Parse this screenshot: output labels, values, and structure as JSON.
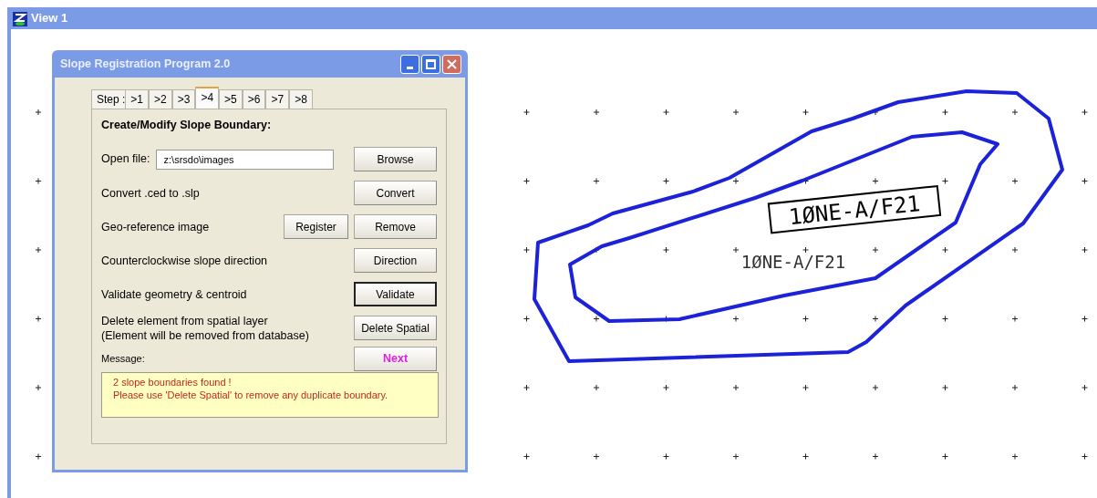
{
  "window": {
    "title": "View 1"
  },
  "canvas": {
    "labels": [
      {
        "text": "1ØNE-A/F21",
        "kind": "boxed"
      },
      {
        "text": "1ØNE-A/F21",
        "kind": "plain"
      }
    ]
  },
  "dialog": {
    "title": "Slope Registration Program 2.0",
    "tabs_prefix": "Step :",
    "tabs": [
      {
        "label": ">1",
        "selected": false
      },
      {
        "label": ">2",
        "selected": false
      },
      {
        "label": ">3",
        "selected": false
      },
      {
        "label": ">4",
        "selected": true
      },
      {
        "label": ">5",
        "selected": false
      },
      {
        "label": ">6",
        "selected": false
      },
      {
        "label": ">7",
        "selected": false
      },
      {
        "label": ">8",
        "selected": false
      }
    ],
    "heading": "Create/Modify Slope Boundary:",
    "file": {
      "label": "Open file:",
      "value": "z:\\srsdo\\images",
      "button": "Browse"
    },
    "rows": [
      {
        "label": "Convert .ced to .slp",
        "buttons": [
          {
            "label": "Convert",
            "focused": false
          }
        ]
      },
      {
        "label": "Geo-reference image",
        "buttons": [
          {
            "label": "Register",
            "focused": false
          },
          {
            "label": "Remove",
            "focused": false
          }
        ]
      },
      {
        "label": "Counterclockwise slope direction",
        "buttons": [
          {
            "label": "Direction",
            "focused": false
          }
        ]
      },
      {
        "label": "Validate geometry & centroid",
        "buttons": [
          {
            "label": "Validate",
            "focused": true
          }
        ]
      },
      {
        "label": "Delete element  from spatial layer\n(Element will be removed from database)",
        "buttons": [
          {
            "label": "Delete Spatial",
            "focused": false
          }
        ]
      }
    ],
    "message_label": "Message:",
    "next_button": "Next",
    "message": [
      "2 slope boundaries found !",
      "Please use 'Delete Spatial' to remove any duplicate boundary."
    ]
  }
}
